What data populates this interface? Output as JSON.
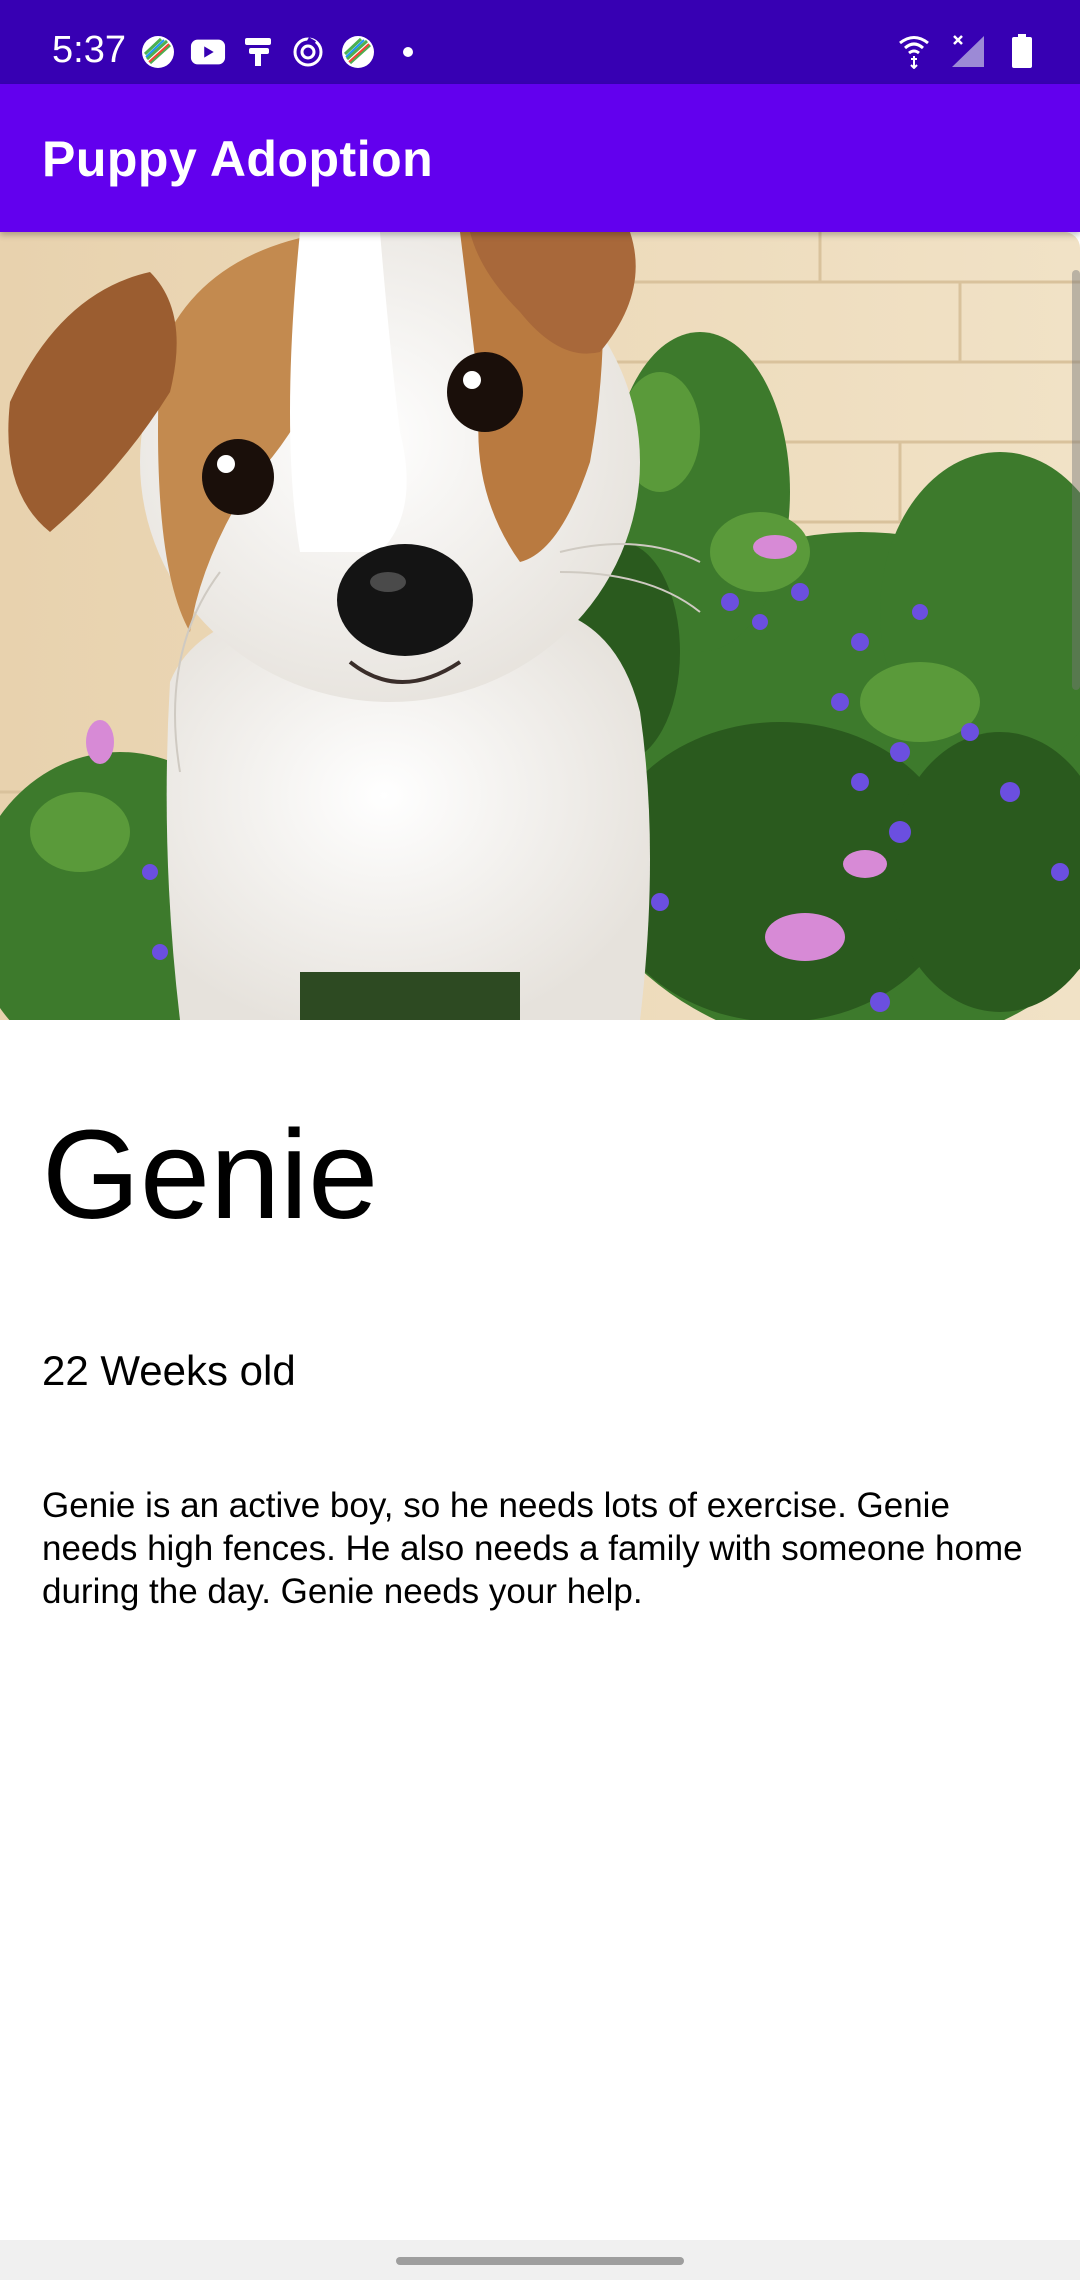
{
  "status_bar": {
    "time": "5:37",
    "left_icons": [
      "sports-ball-icon",
      "youtube-icon",
      "bundle-icon",
      "sync-icon",
      "sports-ball-icon",
      "dot-icon"
    ],
    "right_icons": [
      "wifi-icon",
      "cell-signal-off-icon",
      "battery-icon"
    ]
  },
  "app_bar": {
    "title": "Puppy Adoption"
  },
  "puppy": {
    "image_alt": "puppy-photo",
    "name": "Genie",
    "age": "22 Weeks old",
    "description": "Genie is an active boy, so he needs lots of exercise. Genie needs high fences. He also needs a family with someone home during the day. Genie needs your help."
  },
  "colors": {
    "status_bar": "#3700b3",
    "app_bar": "#6200ee",
    "background": "#ffffff",
    "text": "#000000"
  }
}
